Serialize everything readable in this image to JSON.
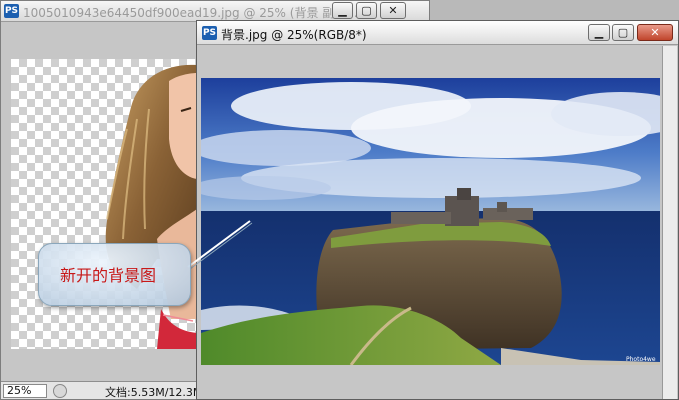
{
  "back_window": {
    "app_icon": "PS",
    "title": "1005010943e64450df900ead19.jpg @ 25% (背景 副本,...",
    "zoom": "25%",
    "doc_info": "文档:5.53M/12.3M"
  },
  "front_window": {
    "app_icon": "PS",
    "title": "背景.jpg @ 25%(RGB/8*)",
    "image_watermark": "Photo4we"
  },
  "window_controls": {
    "minimize": "▁",
    "maximize": "▢",
    "close": "✕"
  },
  "annotation": {
    "callout_text": "新开的背景图"
  },
  "colors": {
    "callout_text": "#c81818",
    "title_inactive": "#9a9a9a",
    "title_active": "#111111"
  }
}
